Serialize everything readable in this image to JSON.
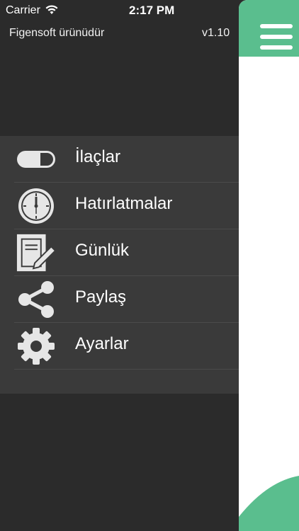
{
  "status_bar": {
    "carrier": "Carrier",
    "time": "2:17 PM"
  },
  "header": {
    "brand": "Figensoft ürünüdür",
    "version": "v1.10"
  },
  "menu": {
    "items": [
      {
        "label": "İlaçlar",
        "icon": "pill-icon"
      },
      {
        "label": "Hatırlatmalar",
        "icon": "clock-icon"
      },
      {
        "label": "Günlük",
        "icon": "journal-icon"
      },
      {
        "label": "Paylaş",
        "icon": "share-icon"
      },
      {
        "label": "Ayarlar",
        "icon": "gear-icon"
      }
    ]
  },
  "panel": {
    "menu_icon": "hamburger-icon"
  },
  "colors": {
    "accent": "#5abe8e",
    "drawer_bg": "#2b2b2b",
    "menu_bg": "#3a3a3a",
    "icon": "#e6e6e6"
  }
}
